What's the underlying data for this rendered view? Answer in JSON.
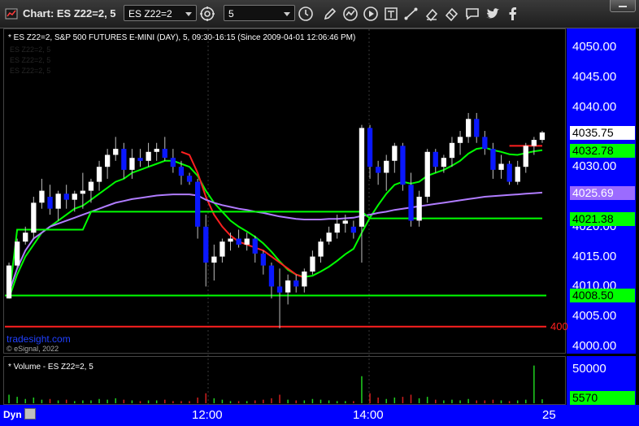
{
  "window": {
    "title": "Chart: ES Z22=2, 5",
    "symbol_value": "ES Z22=2",
    "interval_value": "5"
  },
  "toolbar_icons": [
    "chart-settings-icon",
    "clock-icon",
    "draw-pencil-icon",
    "study-icon",
    "play-icon",
    "text-tool-icon",
    "trendline-icon",
    "eraser-icon",
    "chat-icon",
    "twitter-icon",
    "facebook-icon"
  ],
  "chart": {
    "header": "* ES Z22=2, S&P 500 FUTURES E-MINI (DAY), 5, 09:30-16:15 (Since 2009-04-01 12:06:46 PM)",
    "ghost_lines": [
      "ES Z22=2, 5",
      "ES Z22=2, 5",
      "ES Z22=2, 5"
    ],
    "watermark": "tradesight.com",
    "copyright": "© eSignal, 2022",
    "partial_label": "400",
    "price_axis_labels": [
      "4050.00",
      "4045.00",
      "4040.00",
      "4035.00",
      "4030.00",
      "4025.00",
      "4020.00",
      "4015.00",
      "4010.00",
      "4005.00",
      "4000.00"
    ],
    "price_tags": [
      {
        "text": "4035.75",
        "bg": "#ffffff",
        "fg": "#000000",
        "value": 4035.75
      },
      {
        "text": "4032.78",
        "bg": "#00ff00",
        "fg": "#000000",
        "value": 4032.78
      },
      {
        "text": "4025.69",
        "bg": "#9b6bff",
        "fg": "#ffffff",
        "value": 4025.69
      },
      {
        "text": "4021.38",
        "bg": "#00ff00",
        "fg": "#000000",
        "value": 4021.38
      },
      {
        "text": "4008.50",
        "bg": "#00ff00",
        "fg": "#000000",
        "value": 4008.5
      }
    ],
    "time_labels": [
      "12:00",
      "14:00",
      "25"
    ]
  },
  "volume": {
    "header": "* Volume - ES Z22=2, 5",
    "axis_label": "50000",
    "tag": {
      "text": "5570",
      "bg": "#00ff00",
      "fg": "#000000"
    }
  },
  "footer": {
    "dyn_label": "Dyn"
  },
  "chart_data": {
    "type": "candlestick",
    "ylim": [
      3999,
      4052
    ],
    "ohlc": [
      [
        4008,
        4014,
        4008,
        4013.5
      ],
      [
        4013.5,
        4018,
        4013,
        4017.5
      ],
      [
        4017.5,
        4020,
        4017,
        4019
      ],
      [
        4019,
        4025,
        4018,
        4024
      ],
      [
        4024,
        4028,
        4023,
        4026
      ],
      [
        4025,
        4027,
        4022,
        4023
      ],
      [
        4023,
        4026,
        4021,
        4025.5
      ],
      [
        4025.5,
        4027,
        4023,
        4024.5
      ],
      [
        4024.5,
        4026,
        4022.5,
        4025.5
      ],
      [
        4025.5,
        4029,
        4023,
        4026
      ],
      [
        4026,
        4028,
        4024,
        4027.5
      ],
      [
        4027.5,
        4031,
        4026,
        4030
      ],
      [
        4030,
        4033,
        4028,
        4032
      ],
      [
        4032,
        4035,
        4031,
        4033
      ],
      [
        4033,
        4034,
        4028,
        4029.5
      ],
      [
        4029.5,
        4033,
        4028,
        4031.5
      ],
      [
        4031.5,
        4033,
        4030,
        4031
      ],
      [
        4031,
        4034,
        4030,
        4032.5
      ],
      [
        4032.5,
        4034,
        4031,
        4033
      ],
      [
        4033,
        4035,
        4031,
        4031.5
      ],
      [
        4031.5,
        4033,
        4029,
        4030
      ],
      [
        4030,
        4031,
        4027,
        4028.5
      ],
      [
        4028.5,
        4029,
        4027,
        4027.5
      ],
      [
        4027.5,
        4028,
        4018,
        4020
      ],
      [
        4020,
        4022,
        4010,
        4014
      ],
      [
        4014,
        4017,
        4011,
        4015
      ],
      [
        4015,
        4018,
        4014,
        4017.5
      ],
      [
        4017.5,
        4019,
        4016,
        4018
      ],
      [
        4018,
        4019.5,
        4016.5,
        4017
      ],
      [
        4017,
        4019,
        4016,
        4018
      ],
      [
        4018,
        4018.5,
        4014,
        4015.5
      ],
      [
        4015.5,
        4016,
        4012,
        4013.5
      ],
      [
        4013.5,
        4014,
        4008,
        4010
      ],
      [
        4010,
        4013,
        4003,
        4009
      ],
      [
        4009,
        4012,
        4007,
        4011
      ],
      [
        4011,
        4012,
        4009,
        4010
      ],
      [
        4010,
        4013,
        4009,
        4012.5
      ],
      [
        4012.5,
        4016,
        4012,
        4015
      ],
      [
        4015,
        4018,
        4014,
        4017.5
      ],
      [
        4017.5,
        4020,
        4017,
        4019
      ],
      [
        4019,
        4022,
        4018,
        4020.5
      ],
      [
        4020.5,
        4022,
        4019,
        4021
      ],
      [
        4020,
        4021,
        4018,
        4019
      ],
      [
        4020,
        4037,
        4014,
        4036.5
      ],
      [
        4036.5,
        4037,
        4028,
        4030
      ],
      [
        4030,
        4031,
        4027,
        4029
      ],
      [
        4029,
        4032,
        4026,
        4031
      ],
      [
        4031,
        4034,
        4029,
        4033.5
      ],
      [
        4033.5,
        4034,
        4026,
        4027
      ],
      [
        4027,
        4029,
        4020,
        4021
      ],
      [
        4021,
        4026,
        4020,
        4025
      ],
      [
        4025,
        4033,
        4024,
        4032.5
      ],
      [
        4032.5,
        4033,
        4029,
        4030
      ],
      [
        4030,
        4032,
        4029,
        4031.5
      ],
      [
        4031.5,
        4035,
        4030,
        4034
      ],
      [
        4034,
        4036,
        4032,
        4035
      ],
      [
        4035,
        4039,
        4034,
        4038
      ],
      [
        4038,
        4039,
        4034,
        4035
      ],
      [
        4035,
        4036,
        4032,
        4033
      ],
      [
        4033,
        4034,
        4028,
        4029.5
      ],
      [
        4029.5,
        4032,
        4028,
        4030.5
      ],
      [
        4030.5,
        4031,
        4027,
        4027.5
      ],
      [
        4027.5,
        4031,
        4027,
        4030
      ],
      [
        4030,
        4034,
        4029,
        4033.5
      ],
      [
        4033.5,
        4035,
        4032,
        4034.5
      ],
      [
        4034.5,
        4036,
        4034,
        4035.75
      ]
    ],
    "series": [
      {
        "color": "#00ff00",
        "values": [
          4008,
          4012,
          4015,
          4017,
          4019,
          4020,
          4021,
          4022,
          4023,
          4023.5,
          4024.5,
          4025.5,
          4026.5,
          4027.5,
          4028,
          4029,
          4029.5,
          4030,
          4030.5,
          4031,
          4031,
          4030.5,
          4030,
          4028.5,
          4026,
          4024,
          4022.5,
          4021,
          4020,
          4019.2,
          4018.3,
          4017.2,
          4015.8,
          4014.2,
          4012.8,
          4012,
          4011.6,
          4011.8,
          4012.5,
          4013.3,
          4014.3,
          4015.4,
          4016.3,
          4019,
          4021.5,
          4023.6,
          4025.5,
          4027,
          4027.5,
          4027.2,
          4027.5,
          4028.5,
          4029,
          4029.5,
          4030.2,
          4031,
          4032.2,
          4033,
          4033.2,
          4032.8,
          4032.5,
          4032.1,
          4032,
          4032.3,
          4032.6,
          4032.78
        ]
      },
      {
        "color": "#ff2020",
        "values": [
          null,
          null,
          null,
          null,
          null,
          null,
          null,
          null,
          null,
          null,
          null,
          null,
          null,
          null,
          null,
          null,
          null,
          null,
          null,
          null,
          null,
          4032.5,
          4032,
          4029,
          4025,
          4022,
          4020,
          4018.5,
          4017.5,
          4017,
          4016.5,
          4016,
          4015,
          4014,
          4013,
          4012,
          4011.5,
          null,
          null,
          null,
          null,
          null,
          null,
          null,
          null,
          null,
          null,
          null,
          null,
          null,
          null,
          null,
          null,
          null,
          null,
          null,
          null,
          null,
          null,
          null,
          null,
          4033.5,
          4033.5,
          4033.5,
          4033.5,
          4033.5
        ]
      },
      {
        "color": "#b07cff",
        "values": [
          4009,
          4013,
          4016,
          4018,
          4019,
          4020,
          4020.5,
          4021,
          4021.5,
          4022,
          4022.5,
          4023,
          4023.5,
          4024,
          4024.3,
          4024.6,
          4024.8,
          4025,
          4025.2,
          4025.3,
          4025.4,
          4025.4,
          4025.4,
          4025.2,
          4024.5,
          4024,
          4023.6,
          4023.3,
          4023,
          4022.8,
          4022.5,
          4022.3,
          4022,
          4021.7,
          4021.5,
          4021.3,
          4021.2,
          4021.2,
          4021.2,
          4021.3,
          4021.3,
          4021.4,
          4021.5,
          4021.8,
          4022,
          4022.3,
          4022.5,
          4022.8,
          4023,
          4023.2,
          4023.4,
          4023.6,
          4023.8,
          4024,
          4024.2,
          4024.4,
          4024.6,
          4024.8,
          4025,
          4025.1,
          4025.2,
          4025.3,
          4025.4,
          4025.5,
          4025.6,
          4025.69
        ]
      },
      {
        "color": "#00ff00",
        "values": [
          4008,
          4019.5,
          4019.5,
          4019.5,
          4019.5,
          4019.5,
          4019.5,
          4019.5,
          4019.5,
          4019.5,
          4022.5,
          4022.5,
          4022.5,
          4022.5,
          4022.5,
          4022.5,
          4022.5,
          4022.5,
          4022.5,
          4022.5,
          4022.5,
          4022.5,
          4022.5,
          4022.5,
          4022.5,
          4022.5,
          4022.5,
          4022.5,
          4022.5,
          4022.5,
          4022.5,
          4022.5,
          4022.5,
          4022.5,
          4022.5,
          4022.5,
          4022.5,
          4022.5,
          4022.5,
          4022.5,
          4022.5,
          4022.5,
          4022.5,
          4022.5,
          4021.38,
          4021.38,
          4021.38,
          4021.38,
          4021.38,
          4021.38,
          4021.38,
          4021.38,
          4021.38,
          4021.38,
          4021.38,
          4021.38,
          4021.38,
          4021.38,
          4021.38,
          4021.38,
          4021.38,
          4021.38,
          4021.38,
          4021.38,
          4021.38,
          4021.38
        ]
      }
    ],
    "hlines": [
      {
        "value": 4008.5,
        "color": "#00ff00"
      },
      {
        "value": 4003.3,
        "color": "#ff2020"
      }
    ],
    "volume": {
      "ylim": [
        0,
        56000
      ],
      "values": [
        12000,
        9000,
        6000,
        8000,
        5000,
        6000,
        4000,
        5000,
        3000,
        4000,
        4000,
        6000,
        5000,
        7000,
        5000,
        4000,
        3000,
        4000,
        4000,
        5000,
        3000,
        3000,
        3000,
        8000,
        14000,
        7000,
        5000,
        3000,
        3000,
        3000,
        4000,
        5000,
        7000,
        12000,
        5000,
        4000,
        4000,
        6000,
        5000,
        4000,
        3000,
        3000,
        3000,
        38000,
        14000,
        8000,
        6000,
        8000,
        9000,
        12000,
        7000,
        9000,
        5000,
        4000,
        5000,
        4000,
        6000,
        4000,
        4000,
        5000,
        4000,
        3000,
        4000,
        5000,
        53000,
        5570
      ]
    }
  }
}
